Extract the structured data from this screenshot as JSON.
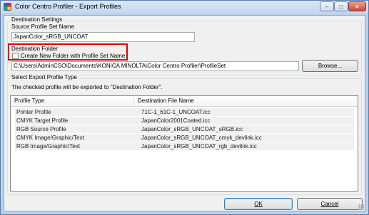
{
  "window": {
    "title": "Color Centro Profiler - Export Profiles",
    "minimize_glyph": "–",
    "maximize_glyph": "□",
    "close_glyph": "✕"
  },
  "destination": {
    "group_caption": "Destination Settings",
    "source_set_label": "Source Profile Set Name",
    "source_set_value": "JapanColor_sRGB_UNCOAT",
    "folder_label": "Destination Folder",
    "create_folder_label": "Create New Folder with Profile Set Name",
    "create_folder_checked": false,
    "folder_path": "C:\\Users\\AdminCSO\\Documents\\KONICA MINOLTA\\Color Centro Profiler\\ProfileSet",
    "browse_label": "Browse..."
  },
  "export_type": {
    "group_caption": "Select Export Profile Type",
    "note": "The checked profile will be exported to \"Destination Folder\".",
    "columns": [
      "Profile Type",
      "Destination File Name"
    ],
    "rows": [
      {
        "type": "Printer Profile",
        "file": "71C-1_61C-1_UNCOAT.icc"
      },
      {
        "type": "CMYK Target Profile",
        "file": "JapanColor2001Coated.icc"
      },
      {
        "type": "RGB Source Profile",
        "file": "JapanColor_sRGB_UNCOAT_sRGB.icc"
      },
      {
        "type": "CMYK Image/Graphic/Text",
        "file": "JapanColor_sRGB_UNCOAT_cmyk_devlink.icc"
      },
      {
        "type": "RGB Image/Graphic/Text",
        "file": "JapanColor_sRGB_UNCOAT_rgb_devlink.icc"
      }
    ]
  },
  "footer": {
    "ok_label": "OK",
    "cancel_label": "Cancel"
  }
}
